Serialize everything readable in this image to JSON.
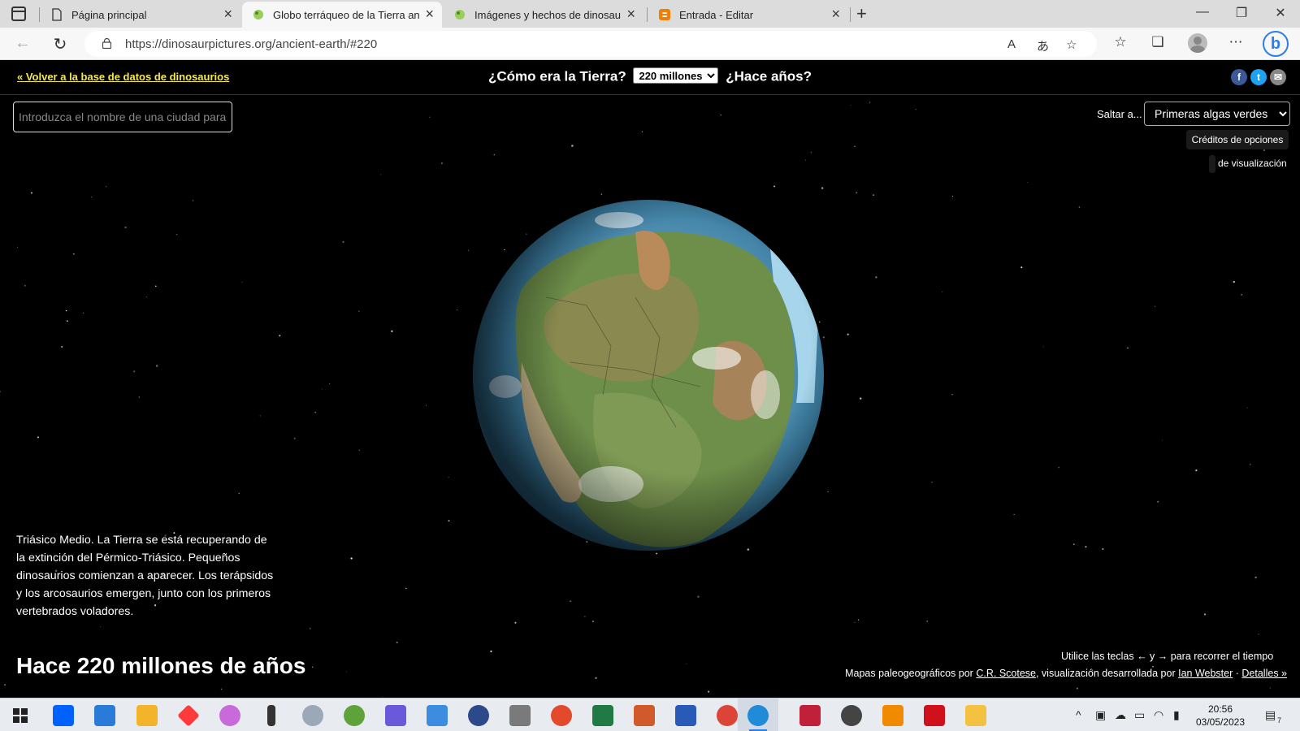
{
  "browser": {
    "tabs": [
      {
        "label": "Página principal",
        "active": false
      },
      {
        "label": "Globo terráqueo de la Tierra anti",
        "active": true
      },
      {
        "label": "Imágenes y hechos de dinosaurio",
        "active": false
      },
      {
        "label": "Entrada - Editar",
        "active": false
      }
    ],
    "url": "https://dinosaurpictures.org/ancient-earth/#220"
  },
  "page": {
    "back_link": "« Volver a la base de datos de dinosaurios",
    "heading_before": "¿Cómo era la Tierra?",
    "heading_after": "¿Hace años?",
    "era_selected": "220 millones",
    "search_placeholder": "Introduzca el nombre de una ciudad para v",
    "jump_label": "Saltar a...",
    "jump_selected": "Primeras algas verdes",
    "credits_button": "Créditos de opciones",
    "view_label": "de visualización",
    "description": "Triásico Medio. La Tierra se está recuperando de la extinción del Pérmico-Triásico. Pequeños dinosaurios comienzan a aparecer. Los terápsidos y los arcosaurios emergen, junto con los primeros vertebrados voladores.",
    "age_title": "Hace 220 millones de años",
    "keys_hint": "Utilice las teclas ← y → para recorrer el tiempo",
    "credits_prefix": "Mapas paleogeográficos por",
    "credits_author1": "C.R. Scotese",
    "credits_middle": ", visualización desarrollada por",
    "credits_author2": "Ian Webster",
    "credits_sep": "·",
    "credits_details": "Detalles »",
    "share_icons": [
      "facebook-icon",
      "twitter-icon",
      "email-icon"
    ]
  },
  "taskbar": {
    "time": "20:56",
    "date": "03/05/2023",
    "notification_count": "7"
  },
  "colors": {
    "link_yellow": "#f6e94a",
    "facebook": "#3b5998",
    "twitter": "#1da1f2",
    "email": "#888888"
  }
}
